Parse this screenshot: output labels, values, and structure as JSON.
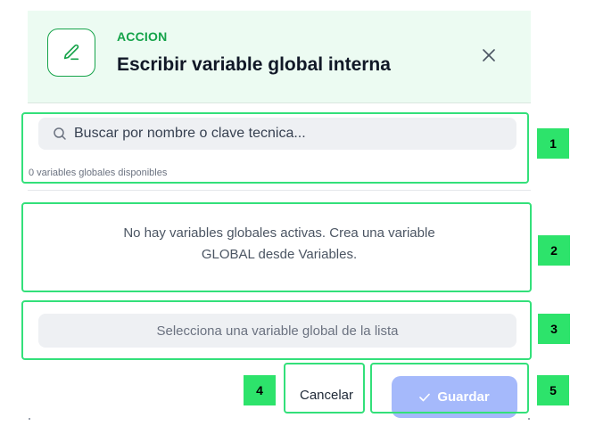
{
  "header": {
    "eyebrow": "ACCION",
    "title": "Escribir variable global interna",
    "icon": "pencil-icon",
    "close_icon": "close-icon"
  },
  "search": {
    "placeholder": "Buscar por nombre o clave tecnica...",
    "value": "",
    "icon": "search-icon",
    "count_text": "0 variables globales disponibles"
  },
  "empty_state": {
    "line1": "No hay variables globales activas. Crea una variable",
    "line2": "GLOBAL desde Variables."
  },
  "selection": {
    "placeholder": "Selecciona una variable global de la lista"
  },
  "footer": {
    "cancel_label": "Cancelar",
    "save_label": "Guardar",
    "save_icon": "check-icon"
  },
  "annotations": {
    "labels": [
      "1",
      "2",
      "3",
      "4",
      "5"
    ]
  },
  "colors": {
    "accent_green": "#16a34a",
    "header_bg": "#ecfbf2",
    "save_button": "#a5b9fb",
    "annotation": "#2de36b"
  }
}
